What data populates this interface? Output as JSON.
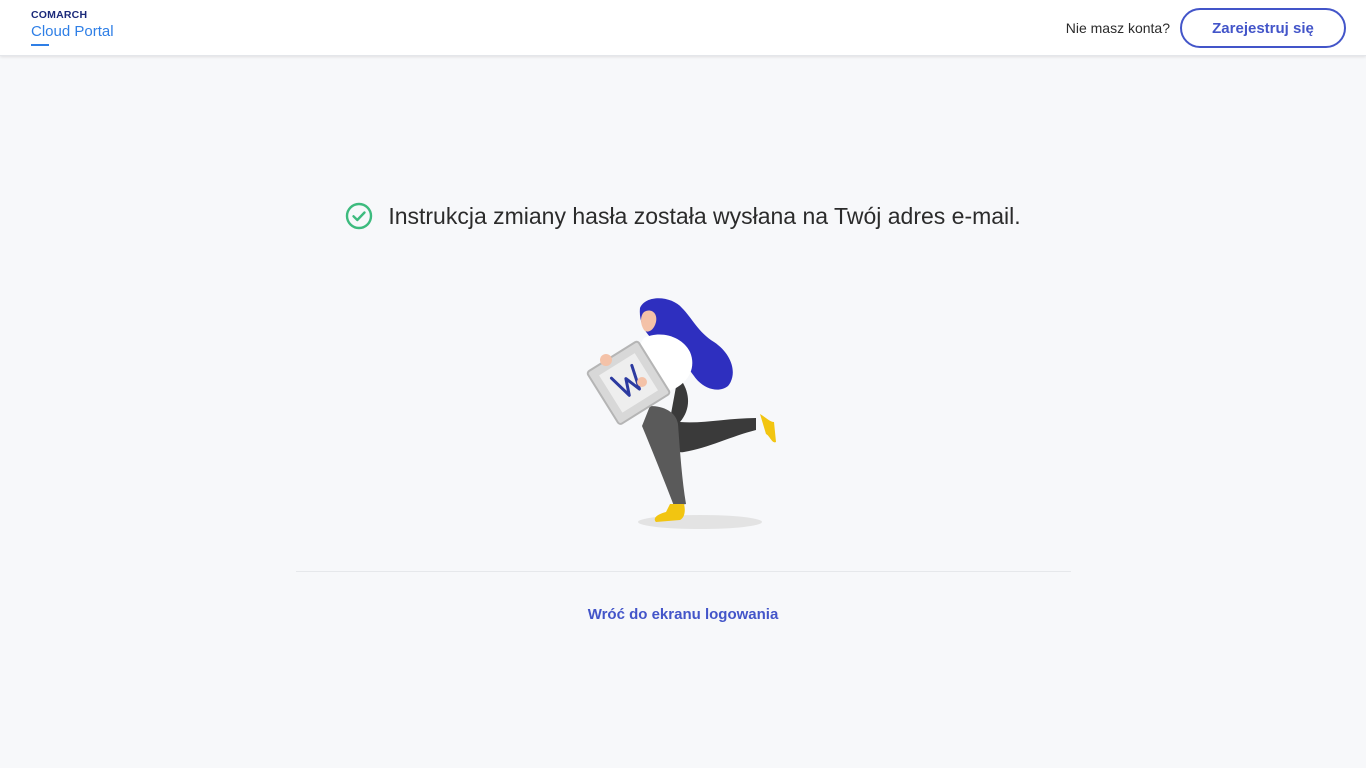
{
  "header": {
    "logo": {
      "company": "COMARCH",
      "product": "Cloud Portal"
    },
    "no_account_text": "Nie masz konta?",
    "register_label": "Zarejestruj się"
  },
  "main": {
    "message": "Instrukcja zmiany hasła została wysłana na Twój adres e-mail.",
    "back_link": "Wróć do ekranu logowania",
    "icons": {
      "success": "check-circle-icon"
    }
  },
  "colors": {
    "accent": "#4355c9",
    "logo_blue": "#2f7fe6",
    "logo_dark": "#1b2a7a",
    "success": "#3dbb7e",
    "hair": "#2e2fbf",
    "shoes": "#f2c511",
    "background": "#f7f8fa"
  }
}
